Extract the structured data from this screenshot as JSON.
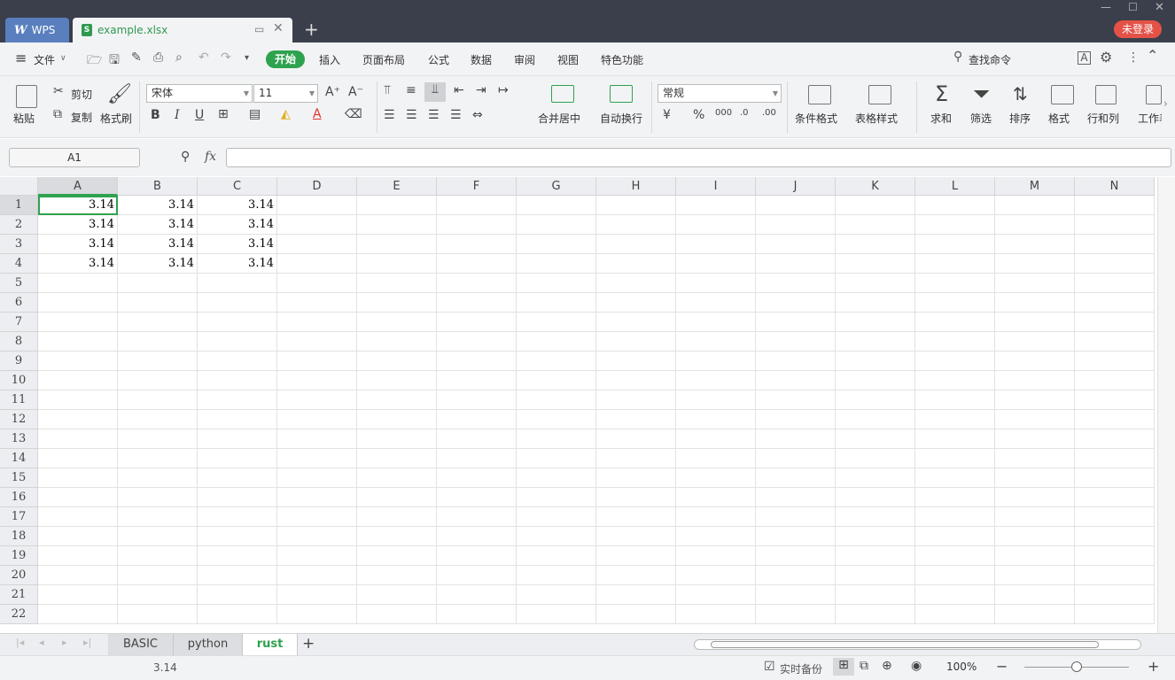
{
  "titlebar": {
    "wps_label": "WPS",
    "file_tab": "example.xlsx",
    "file_badge": "S",
    "new_tab": "+",
    "login_label": "未登录"
  },
  "menubar": {
    "hamburger": "≡",
    "file_menu": "文件",
    "tabs": [
      "开始",
      "插入",
      "页面布局",
      "公式",
      "数据",
      "审阅",
      "视图",
      "特色功能"
    ],
    "search_label": "查找命令"
  },
  "ribbon": {
    "paste": "粘贴",
    "cut": "剪切",
    "copy": "复制",
    "format_painter": "格式刷",
    "font_name": "宋体",
    "font_size": "11",
    "merge_center": "合并居中",
    "wrap_text": "自动换行",
    "number_format": "常规",
    "conditional_format": "条件格式",
    "table_style": "表格样式",
    "sum": "求和",
    "filter": "筛选",
    "sort": "排序",
    "format": "格式",
    "row_col": "行和列",
    "worksheet": "工作表"
  },
  "formula_bar": {
    "name_box": "A1",
    "fx": "fx",
    "value": ""
  },
  "sheet": {
    "columns": [
      "A",
      "B",
      "C",
      "D",
      "E",
      "F",
      "G",
      "H",
      "I",
      "J",
      "K",
      "L",
      "M",
      "N"
    ],
    "rows": [
      "1",
      "2",
      "3",
      "4",
      "5",
      "6",
      "7",
      "8",
      "9",
      "10",
      "11",
      "12",
      "13",
      "14",
      "15",
      "16",
      "17",
      "18",
      "19",
      "20",
      "21",
      "22"
    ],
    "cells": [
      [
        "3.14",
        "3.14",
        "3.14"
      ],
      [
        "3.14",
        "3.14",
        "3.14"
      ],
      [
        "3.14",
        "3.14",
        "3.14"
      ],
      [
        "3.14",
        "3.14",
        "3.14"
      ]
    ],
    "active_cell": "A1"
  },
  "sheet_tabs": [
    "BASIC",
    "python",
    "rust"
  ],
  "active_sheet": "rust",
  "status": {
    "cell_value": "3.14",
    "backup": "实时备份",
    "zoom": "100%"
  },
  "colors": {
    "accent": "#2fa24f",
    "titlebar": "#3a3f4b",
    "login": "#e45247"
  }
}
